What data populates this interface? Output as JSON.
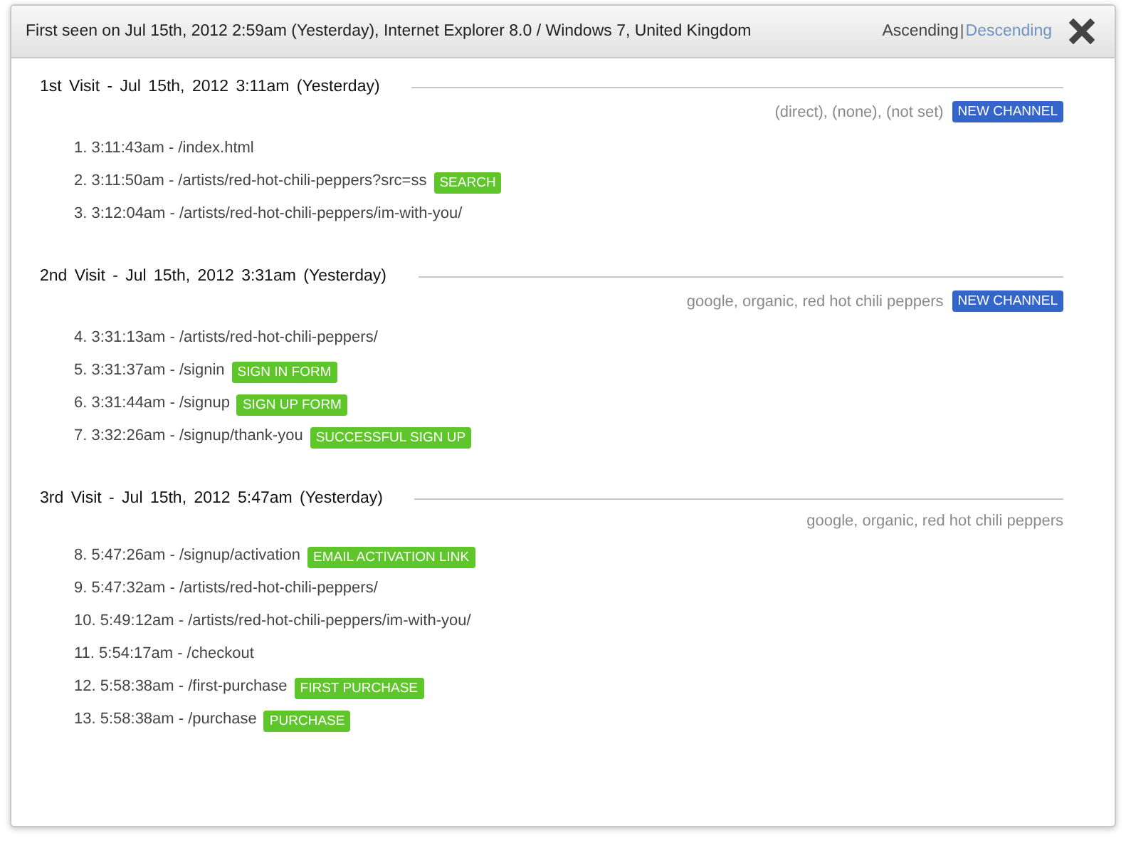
{
  "header": {
    "title": "First seen on Jul 15th, 2012 2:59am (Yesterday), Internet Explorer 8.0 / Windows 7, United Kingdom",
    "sort": [
      {
        "label": "Ascending",
        "selected": true
      },
      {
        "label": "Descending",
        "selected": false
      }
    ],
    "separator": "|"
  },
  "visits": [
    {
      "title": "1st Visit - Jul 15th, 2012 3:11am (Yesterday)",
      "source": "(direct), (none), (not set)",
      "badge": "NEW CHANNEL",
      "pages": [
        {
          "text": "1. 3:11:43am - /index.html"
        },
        {
          "text": "2. 3:11:50am - /artists/red-hot-chili-peppers?src=ss",
          "tag": "SEARCH"
        },
        {
          "text": "3. 3:12:04am - /artists/red-hot-chili-peppers/im-with-you/"
        }
      ]
    },
    {
      "title": "2nd Visit - Jul 15th, 2012 3:31am (Yesterday)",
      "source": "google, organic, red hot chili peppers",
      "badge": "NEW CHANNEL",
      "pages": [
        {
          "text": "4. 3:31:13am - /artists/red-hot-chili-peppers/"
        },
        {
          "text": "5. 3:31:37am - /signin",
          "tag": "SIGN IN FORM"
        },
        {
          "text": "6. 3:31:44am - /signup",
          "tag": "SIGN UP FORM"
        },
        {
          "text": "7. 3:32:26am - /signup/thank-you",
          "tag": "SUCCESSFUL SIGN UP"
        }
      ]
    },
    {
      "title": "3rd Visit - Jul 15th, 2012 5:47am (Yesterday)",
      "source": "google, organic, red hot chili peppers",
      "pages": [
        {
          "text": "8. 5:47:26am - /signup/activation",
          "tag": "EMAIL ACTIVATION LINK"
        },
        {
          "text": "9. 5:47:32am - /artists/red-hot-chili-peppers/"
        },
        {
          "text": "10. 5:49:12am - /artists/red-hot-chili-peppers/im-with-you/"
        },
        {
          "text": "11. 5:54:17am - /checkout"
        },
        {
          "text": "12. 5:58:38am - /first-purchase",
          "tag": "FIRST PURCHASE"
        },
        {
          "text": "13. 5:58:38am - /purchase",
          "tag": "PURCHASE"
        }
      ]
    }
  ]
}
